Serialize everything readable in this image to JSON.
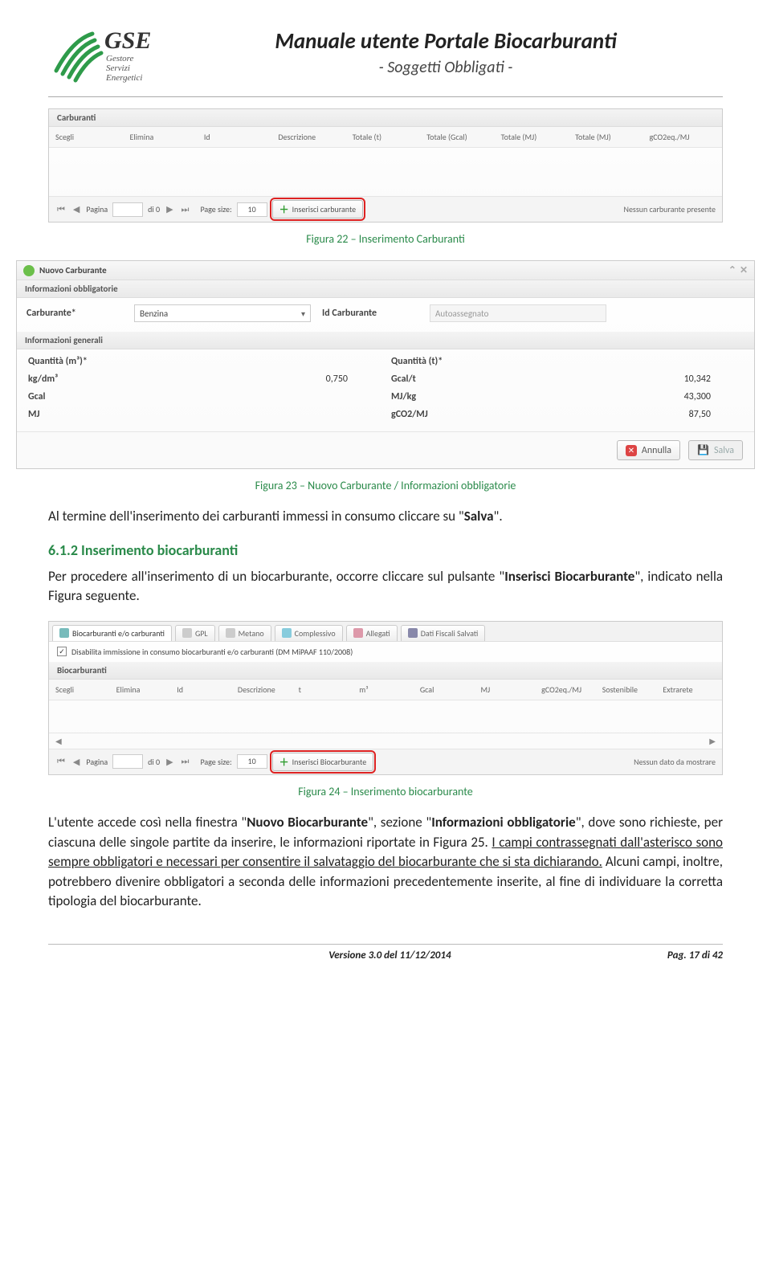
{
  "header": {
    "logo_main": "GSE",
    "logo_sub1": "Gestore",
    "logo_sub2": "Servizi",
    "logo_sub3": "Energetici",
    "title": "Manuale utente Portale Biocarburanti",
    "subtitle": "- Soggetti Obbligati -"
  },
  "ss1": {
    "tab": "Carburanti",
    "cols": [
      "Scegli",
      "Elimina",
      "Id",
      "Descrizione",
      "Totale (t)",
      "Totale (Gcal)",
      "Totale (MJ)",
      "Totale (MJ)",
      "gCO2eq./MJ"
    ],
    "pagina": "Pagina",
    "di0": "di 0",
    "pagesize_lbl": "Page size:",
    "pagesize_val": "10",
    "btn": "Inserisci carburante",
    "right": "Nessun carburante presente"
  },
  "caption1": "Figura 22 – Inserimento Carburanti",
  "ss2": {
    "win_title": "Nuovo Carburante",
    "section": "Informazioni obbligatorie",
    "lbl_carb": "Carburante*",
    "sel_carb": "Benzina",
    "lbl_id": "Id Carburante",
    "id_ph": "Autoassegnato",
    "section2": "Informazioni generali",
    "grid": {
      "k1": "Quantità (m³)*",
      "v1": "",
      "k2": "Quantità (t)*",
      "v2": "",
      "k3": "kg/dm³",
      "v3": "0,750",
      "k4": "Gcal/t",
      "v4": "10,342",
      "k5": "Gcal",
      "v5": "",
      "k6": "MJ/kg",
      "v6": "43,300",
      "k7": "MJ",
      "v7": "",
      "k8": "gCO2/MJ",
      "v8": "87,50"
    },
    "btn_cancel": "Annulla",
    "btn_save": "Salva"
  },
  "caption2": "Figura 23 – Nuovo Carburante / Informazioni obbligatorie",
  "para1_a": "Al termine dell'inserimento dei carburanti immessi in consumo cliccare su \"",
  "para1_b": "Salva",
  "para1_c": "\".",
  "h2": "6.1.2  Inserimento biocarburanti",
  "para2_a": "Per procedere all'inserimento di un biocarburante, occorre cliccare sul pulsante \"",
  "para2_b": "Inserisci Biocarburante",
  "para2_c": "\", indicato nella Figura seguente.",
  "ss3": {
    "tabs": [
      "Biocarburanti e/o carburanti",
      "GPL",
      "Metano",
      "Complessivo",
      "Allegati",
      "Dati Fiscali Salvati"
    ],
    "disab": "Disabilita immissione in consumo biocarburanti e/o carburanti (DM MiPAAF 110/2008)",
    "subtab": "Biocarburanti",
    "cols": [
      "Scegli",
      "Elimina",
      "Id",
      "Descrizione",
      "t",
      "m³",
      "Gcal",
      "MJ",
      "gCO2eq./MJ",
      "Sostenibile",
      "Extrarete"
    ],
    "pagina": "Pagina",
    "di0": "di 0",
    "pagesize_lbl": "Page size:",
    "pagesize_val": "10",
    "btn": "Inserisci Biocarburante",
    "right": "Nessun dato da mostrare"
  },
  "caption3": "Figura 24 – Inserimento biocarburante",
  "para3_a": "L'utente accede così nella finestra \"",
  "para3_b": "Nuovo Biocarburante",
  "para3_c": "\", sezione \"",
  "para3_d": "Informazioni obbligatorie",
  "para3_e": "\", dove sono richieste, per ciascuna delle singole partite da inserire, le informazioni riportate in Figura 25. ",
  "para3_f": "I campi contrassegnati dall'asterisco sono sempre obbligatori e necessari per consentire il salvataggio del biocarburante che si sta dichiarando.",
  "para3_g": " Alcuni campi, inoltre, potrebbero divenire obbligatori a seconda delle informazioni precedentemente inserite, al fine di individuare la corretta tipologia del biocarburante.",
  "footer": {
    "center": "Versione 3.0 del 11/12/2014",
    "right": "Pag. 17 di 42"
  }
}
